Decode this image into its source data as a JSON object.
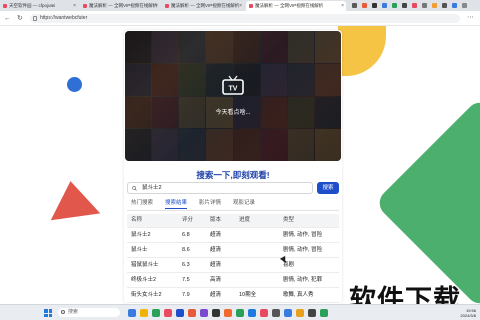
{
  "browser": {
    "tabs": [
      {
        "label": "天空软件园 — cfpojutei"
      },
      {
        "label": "魔法解析 — 全网VIP视频在线解析"
      },
      {
        "label": "魔法解析 — 全网VIP视频在线解析"
      },
      {
        "label": "魔法解析 — 全网VIP视频在线解析"
      }
    ],
    "url": "https://wantwebcfuter"
  },
  "hero": {
    "caption": "今天看点啥...",
    "icon": "tv-icon",
    "tv_label": "TV"
  },
  "search": {
    "title": "搜索一下,即刻观看!",
    "value": "鼠斗士2",
    "button_label": "搜索"
  },
  "tabs": [
    "热门搜索",
    "搜索结果",
    "影片详情",
    "观影记录"
  ],
  "active_tab": 1,
  "table": {
    "columns": [
      "名称",
      "评分",
      "版本",
      "进度",
      "类型"
    ],
    "rows": [
      [
        "鼠斗士2",
        "6.8",
        "超清",
        "",
        "剧情, 动作, 冒险"
      ],
      [
        "鼠斗士",
        "8.6",
        "超清",
        "",
        "剧情, 动作, 冒险"
      ],
      [
        "猎鼠鼠斗士",
        "6.3",
        "超清",
        "",
        "喜剧"
      ],
      [
        "终极斗士2",
        "7.5",
        "高清",
        "",
        "剧情, 动作, 犯罪"
      ],
      [
        "街头女斗士2",
        "7.9",
        "超清",
        "10期全",
        "歌舞, 真人秀"
      ]
    ]
  },
  "watermark": "软件下载",
  "taskbar": {
    "search_placeholder": "搜索",
    "time": "19:56",
    "date": "2024/3/8"
  },
  "colors": {
    "accent": "#1e4fc8",
    "title_blue": "#1c3fa8",
    "yellow": "#f6c445",
    "green": "#4caf6e",
    "red": "#e2574c",
    "blue": "#2f6fd6"
  }
}
